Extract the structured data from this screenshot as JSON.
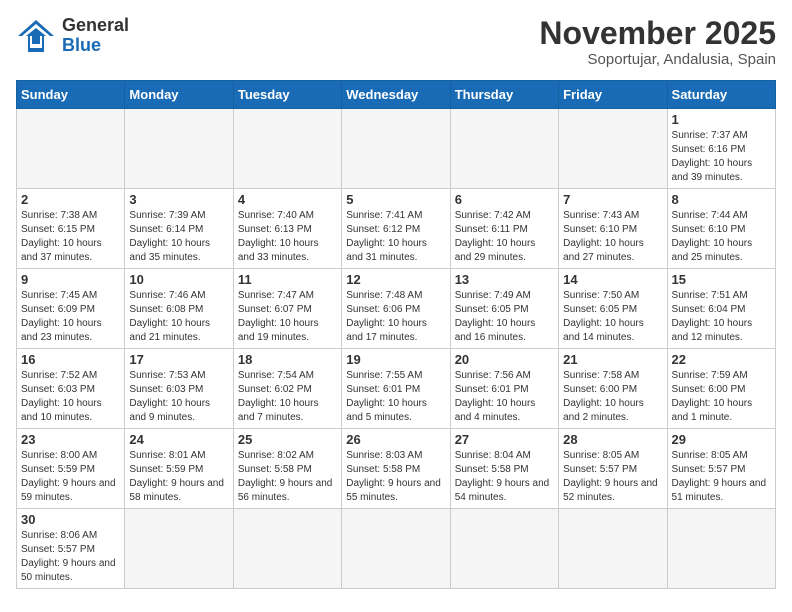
{
  "header": {
    "logo_general": "General",
    "logo_blue": "Blue",
    "month": "November 2025",
    "location": "Soportujar, Andalusia, Spain"
  },
  "weekdays": [
    "Sunday",
    "Monday",
    "Tuesday",
    "Wednesday",
    "Thursday",
    "Friday",
    "Saturday"
  ],
  "weeks": [
    [
      {
        "day": "",
        "info": ""
      },
      {
        "day": "",
        "info": ""
      },
      {
        "day": "",
        "info": ""
      },
      {
        "day": "",
        "info": ""
      },
      {
        "day": "",
        "info": ""
      },
      {
        "day": "",
        "info": ""
      },
      {
        "day": "1",
        "info": "Sunrise: 7:37 AM\nSunset: 6:16 PM\nDaylight: 10 hours and 39 minutes."
      }
    ],
    [
      {
        "day": "2",
        "info": "Sunrise: 7:38 AM\nSunset: 6:15 PM\nDaylight: 10 hours and 37 minutes."
      },
      {
        "day": "3",
        "info": "Sunrise: 7:39 AM\nSunset: 6:14 PM\nDaylight: 10 hours and 35 minutes."
      },
      {
        "day": "4",
        "info": "Sunrise: 7:40 AM\nSunset: 6:13 PM\nDaylight: 10 hours and 33 minutes."
      },
      {
        "day": "5",
        "info": "Sunrise: 7:41 AM\nSunset: 6:12 PM\nDaylight: 10 hours and 31 minutes."
      },
      {
        "day": "6",
        "info": "Sunrise: 7:42 AM\nSunset: 6:11 PM\nDaylight: 10 hours and 29 minutes."
      },
      {
        "day": "7",
        "info": "Sunrise: 7:43 AM\nSunset: 6:10 PM\nDaylight: 10 hours and 27 minutes."
      },
      {
        "day": "8",
        "info": "Sunrise: 7:44 AM\nSunset: 6:10 PM\nDaylight: 10 hours and 25 minutes."
      }
    ],
    [
      {
        "day": "9",
        "info": "Sunrise: 7:45 AM\nSunset: 6:09 PM\nDaylight: 10 hours and 23 minutes."
      },
      {
        "day": "10",
        "info": "Sunrise: 7:46 AM\nSunset: 6:08 PM\nDaylight: 10 hours and 21 minutes."
      },
      {
        "day": "11",
        "info": "Sunrise: 7:47 AM\nSunset: 6:07 PM\nDaylight: 10 hours and 19 minutes."
      },
      {
        "day": "12",
        "info": "Sunrise: 7:48 AM\nSunset: 6:06 PM\nDaylight: 10 hours and 17 minutes."
      },
      {
        "day": "13",
        "info": "Sunrise: 7:49 AM\nSunset: 6:05 PM\nDaylight: 10 hours and 16 minutes."
      },
      {
        "day": "14",
        "info": "Sunrise: 7:50 AM\nSunset: 6:05 PM\nDaylight: 10 hours and 14 minutes."
      },
      {
        "day": "15",
        "info": "Sunrise: 7:51 AM\nSunset: 6:04 PM\nDaylight: 10 hours and 12 minutes."
      }
    ],
    [
      {
        "day": "16",
        "info": "Sunrise: 7:52 AM\nSunset: 6:03 PM\nDaylight: 10 hours and 10 minutes."
      },
      {
        "day": "17",
        "info": "Sunrise: 7:53 AM\nSunset: 6:03 PM\nDaylight: 10 hours and 9 minutes."
      },
      {
        "day": "18",
        "info": "Sunrise: 7:54 AM\nSunset: 6:02 PM\nDaylight: 10 hours and 7 minutes."
      },
      {
        "day": "19",
        "info": "Sunrise: 7:55 AM\nSunset: 6:01 PM\nDaylight: 10 hours and 5 minutes."
      },
      {
        "day": "20",
        "info": "Sunrise: 7:56 AM\nSunset: 6:01 PM\nDaylight: 10 hours and 4 minutes."
      },
      {
        "day": "21",
        "info": "Sunrise: 7:58 AM\nSunset: 6:00 PM\nDaylight: 10 hours and 2 minutes."
      },
      {
        "day": "22",
        "info": "Sunrise: 7:59 AM\nSunset: 6:00 PM\nDaylight: 10 hours and 1 minute."
      }
    ],
    [
      {
        "day": "23",
        "info": "Sunrise: 8:00 AM\nSunset: 5:59 PM\nDaylight: 9 hours and 59 minutes."
      },
      {
        "day": "24",
        "info": "Sunrise: 8:01 AM\nSunset: 5:59 PM\nDaylight: 9 hours and 58 minutes."
      },
      {
        "day": "25",
        "info": "Sunrise: 8:02 AM\nSunset: 5:58 PM\nDaylight: 9 hours and 56 minutes."
      },
      {
        "day": "26",
        "info": "Sunrise: 8:03 AM\nSunset: 5:58 PM\nDaylight: 9 hours and 55 minutes."
      },
      {
        "day": "27",
        "info": "Sunrise: 8:04 AM\nSunset: 5:58 PM\nDaylight: 9 hours and 54 minutes."
      },
      {
        "day": "28",
        "info": "Sunrise: 8:05 AM\nSunset: 5:57 PM\nDaylight: 9 hours and 52 minutes."
      },
      {
        "day": "29",
        "info": "Sunrise: 8:05 AM\nSunset: 5:57 PM\nDaylight: 9 hours and 51 minutes."
      }
    ],
    [
      {
        "day": "30",
        "info": "Sunrise: 8:06 AM\nSunset: 5:57 PM\nDaylight: 9 hours and 50 minutes."
      },
      {
        "day": "",
        "info": ""
      },
      {
        "day": "",
        "info": ""
      },
      {
        "day": "",
        "info": ""
      },
      {
        "day": "",
        "info": ""
      },
      {
        "day": "",
        "info": ""
      },
      {
        "day": "",
        "info": ""
      }
    ]
  ]
}
